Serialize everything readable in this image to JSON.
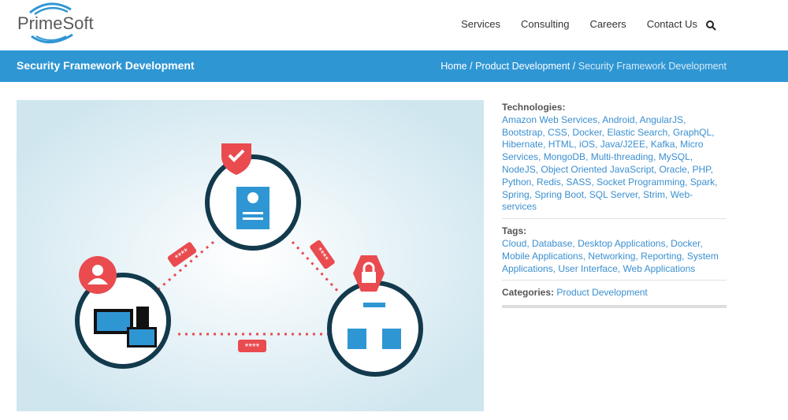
{
  "brand": {
    "name": "PrimeSoft"
  },
  "nav": {
    "items": [
      "Services",
      "Consulting",
      "Careers",
      "Contact Us"
    ]
  },
  "page": {
    "title": "Security Framework Development"
  },
  "breadcrumb": {
    "home": "Home",
    "sep": "/",
    "parent": "Product Development",
    "current": "Security Framework Development"
  },
  "illustration": {
    "token": "****"
  },
  "sidebar": {
    "technologies_label": "Technologies:",
    "technologies": [
      "Amazon Web Services",
      "Android",
      "AngularJS",
      "Bootstrap",
      "CSS",
      "Docker",
      "Elastic Search",
      "GraphQL",
      "Hibernate",
      "HTML",
      "iOS",
      "Java/J2EE",
      "Kafka",
      "Micro Services",
      "MongoDB",
      "Multi-threading",
      "MySQL",
      "NodeJS",
      "Object Oriented JavaScript",
      "Oracle",
      "PHP",
      "Python",
      "Redis",
      "SASS",
      "Socket Programming",
      "Spark",
      "Spring",
      "Spring Boot",
      "SQL Server",
      "Strim",
      "Web-services"
    ],
    "tags_label": "Tags:",
    "tags": [
      "Cloud",
      "Database",
      "Desktop Applications",
      "Docker",
      "Mobile Applications",
      "Networking",
      "Reporting",
      "System Applications",
      "User Interface",
      "Web Applications"
    ],
    "categories_label": "Categories:",
    "categories": [
      "Product Development"
    ]
  },
  "colors": {
    "accent": "#2f96d4",
    "link": "#3a8fd0",
    "red": "#e94b4f",
    "navy": "#123a4c"
  }
}
